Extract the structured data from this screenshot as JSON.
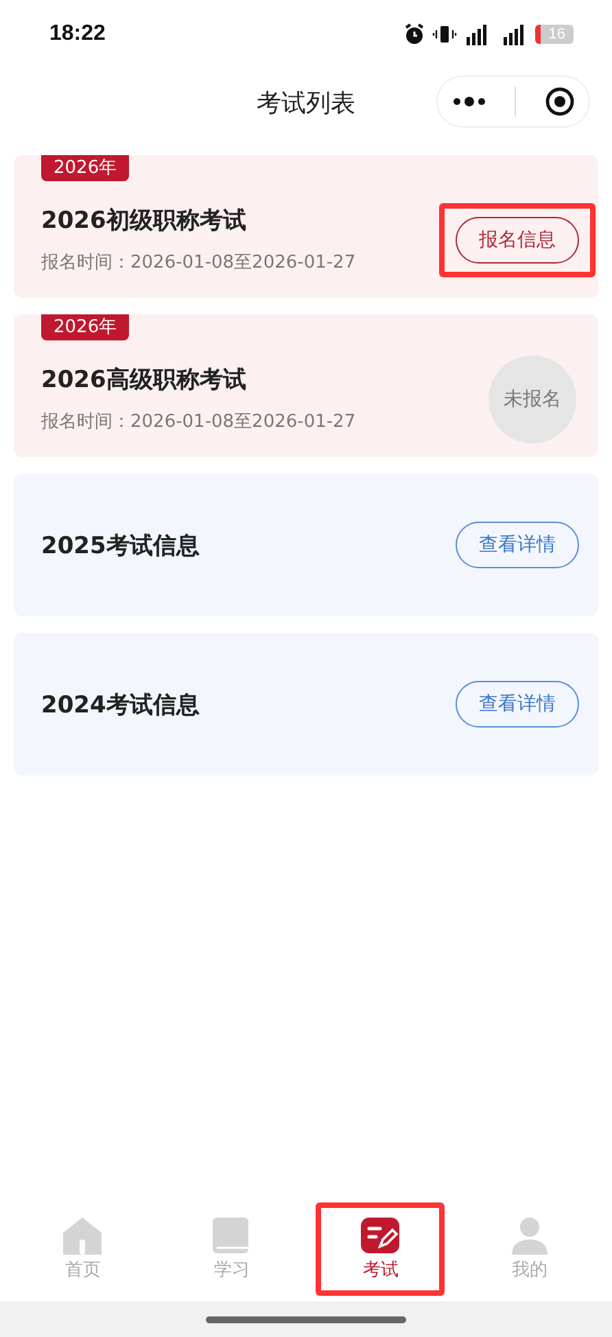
{
  "status_bar": {
    "time": "18:22",
    "battery": "16"
  },
  "nav_bar": {
    "title": "考试列表"
  },
  "exams": [
    {
      "kind": "exam",
      "year_badge": "2026年",
      "title": "2026初级职称考试",
      "period": "报名时间：2026-01-08至2026-01-27",
      "action": {
        "kind": "registered",
        "label": "报名信息",
        "highlighted": true
      }
    },
    {
      "kind": "exam",
      "year_badge": "2026年",
      "title": "2026高级职称考试",
      "period": "报名时间：2026-01-08至2026-01-27",
      "action": {
        "kind": "not_registered",
        "label": "未报名",
        "highlighted": false
      }
    },
    {
      "kind": "info",
      "title": "2025考试信息",
      "action": {
        "kind": "details",
        "label": "查看详情",
        "highlighted": false
      }
    },
    {
      "kind": "info",
      "title": "2024考试信息",
      "action": {
        "kind": "details",
        "label": "查看详情",
        "highlighted": false
      }
    }
  ],
  "tab_bar": [
    {
      "label": "首页",
      "selected": false,
      "highlighted": false
    },
    {
      "label": "学习",
      "selected": false,
      "highlighted": false
    },
    {
      "label": "考试",
      "selected": true,
      "highlighted": true
    },
    {
      "label": "我的",
      "selected": false,
      "highlighted": false
    }
  ]
}
